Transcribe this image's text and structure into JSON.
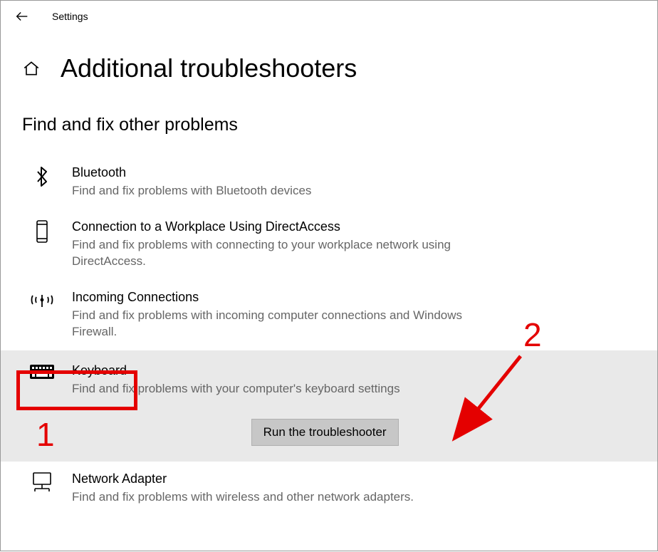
{
  "app_title": "Settings",
  "page_title": "Additional troubleshooters",
  "section_heading": "Find and fix other problems",
  "items": [
    {
      "title": "Bluetooth",
      "desc": "Find and fix problems with Bluetooth devices"
    },
    {
      "title": "Connection to a Workplace Using DirectAccess",
      "desc": "Find and fix problems with connecting to your workplace network using DirectAccess."
    },
    {
      "title": "Incoming Connections",
      "desc": "Find and fix problems with incoming computer connections and Windows Firewall."
    },
    {
      "title": "Keyboard",
      "desc": "Find and fix problems with your computer's keyboard settings"
    },
    {
      "title": "Network Adapter",
      "desc": "Find and fix problems with wireless and other network adapters."
    }
  ],
  "run_button": "Run the troubleshooter",
  "annotations": {
    "label1": "1",
    "label2": "2"
  }
}
